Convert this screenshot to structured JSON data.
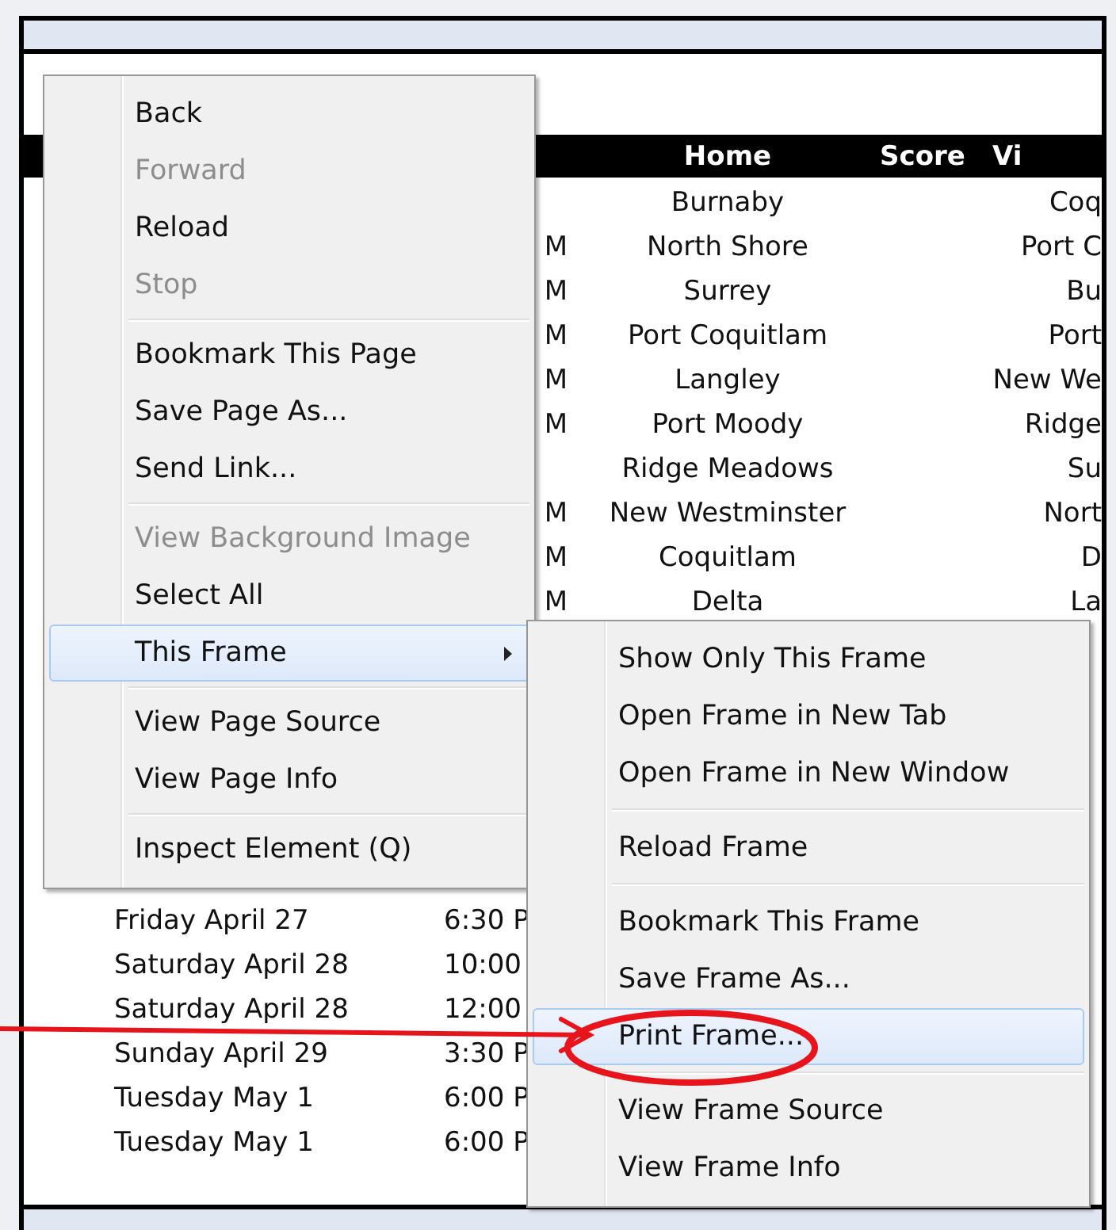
{
  "table": {
    "columns": [
      {
        "label": "Home"
      },
      {
        "label": "Score"
      },
      {
        "label": "Vi"
      }
    ],
    "top_rows": [
      {
        "home": "Burnaby",
        "visitor": "Coq"
      },
      {
        "time": "M",
        "home": "North Shore",
        "visitor": "Port C"
      },
      {
        "time": "M",
        "home": "Surrey",
        "visitor": "Bu"
      },
      {
        "time": "M",
        "home": "Port Coquitlam",
        "visitor": "Port"
      },
      {
        "time": "M",
        "home": "Langley",
        "visitor": "New We"
      },
      {
        "time": "M",
        "home": "Port Moody",
        "visitor": "Ridge"
      },
      {
        "home": "Ridge Meadows",
        "visitor": "Su"
      },
      {
        "time": "M",
        "home": "New Westminster",
        "visitor": "Nort"
      },
      {
        "time": "M",
        "home": "Coquitlam",
        "visitor": "D"
      },
      {
        "time": "M",
        "home": "Delta",
        "visitor": "La"
      }
    ],
    "bottom_rows": [
      {
        "date": "Friday April 27",
        "time": "6:30 P"
      },
      {
        "date": "Saturday April 28",
        "time": "10:00"
      },
      {
        "date": "Saturday April 28",
        "time": "12:00"
      },
      {
        "date": "Sunday April 29",
        "time": "3:30 P"
      },
      {
        "date": "Tuesday May 1",
        "time": "6:00 P"
      },
      {
        "date": "Tuesday May 1",
        "time": "6:00 P"
      }
    ]
  },
  "context_menu": {
    "groups": [
      [
        {
          "label": "Back",
          "disabled": false,
          "highlighted": false,
          "has_submenu": false
        },
        {
          "label": "Forward",
          "disabled": true,
          "highlighted": false,
          "has_submenu": false
        },
        {
          "label": "Reload",
          "disabled": false,
          "highlighted": false,
          "has_submenu": false
        },
        {
          "label": "Stop",
          "disabled": true,
          "highlighted": false,
          "has_submenu": false
        }
      ],
      [
        {
          "label": "Bookmark This Page",
          "disabled": false,
          "highlighted": false,
          "has_submenu": false
        },
        {
          "label": "Save Page As...",
          "disabled": false,
          "highlighted": false,
          "has_submenu": false
        },
        {
          "label": "Send Link...",
          "disabled": false,
          "highlighted": false,
          "has_submenu": false
        }
      ],
      [
        {
          "label": "View Background Image",
          "disabled": true,
          "highlighted": false,
          "has_submenu": false
        },
        {
          "label": "Select All",
          "disabled": false,
          "highlighted": false,
          "has_submenu": false
        },
        {
          "label": "This Frame",
          "disabled": false,
          "highlighted": true,
          "has_submenu": true
        }
      ],
      [
        {
          "label": "View Page Source",
          "disabled": false,
          "highlighted": false,
          "has_submenu": false
        },
        {
          "label": "View Page Info",
          "disabled": false,
          "highlighted": false,
          "has_submenu": false
        }
      ],
      [
        {
          "label": "Inspect Element (Q)",
          "disabled": false,
          "highlighted": false,
          "has_submenu": false
        }
      ]
    ]
  },
  "submenu": {
    "groups": [
      [
        {
          "label": "Show Only This Frame",
          "disabled": false,
          "highlighted": false,
          "has_submenu": false
        },
        {
          "label": "Open Frame in New Tab",
          "disabled": false,
          "highlighted": false,
          "has_submenu": false
        },
        {
          "label": "Open Frame in New Window",
          "disabled": false,
          "highlighted": false,
          "has_submenu": false
        }
      ],
      [
        {
          "label": "Reload Frame",
          "disabled": false,
          "highlighted": false,
          "has_submenu": false
        }
      ],
      [
        {
          "label": "Bookmark This Frame",
          "disabled": false,
          "highlighted": false,
          "has_submenu": false
        },
        {
          "label": "Save Frame As...",
          "disabled": false,
          "highlighted": false,
          "has_submenu": false
        },
        {
          "label": "Print Frame...",
          "disabled": false,
          "highlighted": true,
          "has_submenu": false
        }
      ],
      [
        {
          "label": "View Frame Source",
          "disabled": false,
          "highlighted": false,
          "has_submenu": false
        },
        {
          "label": "View Frame Info",
          "disabled": false,
          "highlighted": false,
          "has_submenu": false
        }
      ]
    ]
  }
}
